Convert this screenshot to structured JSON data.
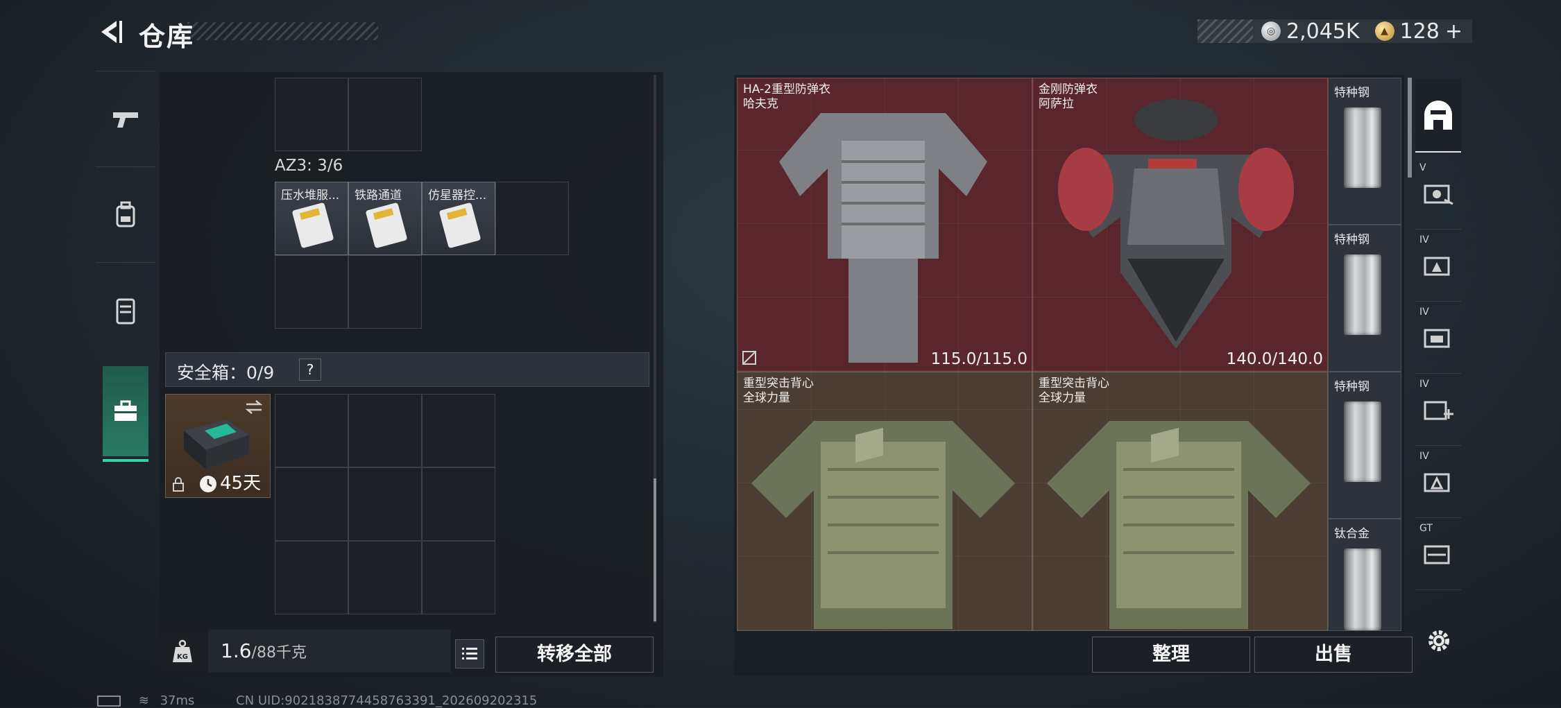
{
  "header": {
    "title": "仓库",
    "currency_silver": "2,045K",
    "currency_gold": "128",
    "gold_add": "+"
  },
  "sidebar": {
    "items": [
      {
        "icon": "pistol-icon"
      },
      {
        "icon": "backpack-icon"
      },
      {
        "icon": "vest-icon"
      },
      {
        "icon": "briefcase-icon",
        "active": true
      }
    ]
  },
  "left_panel": {
    "az3_label": "AZ3: 3/6",
    "az3_items": [
      {
        "label": "压水堆服..."
      },
      {
        "label": "铁路通道"
      },
      {
        "label": "仿星器控..."
      }
    ],
    "safe_box": {
      "label": "安全箱：0/9",
      "help": "?",
      "item_days": "45天"
    },
    "weight": {
      "current": "1.6",
      "max": "/88千克"
    },
    "transfer_all_label": "转移全部"
  },
  "right_panel": {
    "armors": [
      {
        "name": "HA-2重型防弹衣",
        "sub": "哈夫克",
        "durability": "115.0/115.0",
        "bg": "#5a262d"
      },
      {
        "name": "金刚防弹衣",
        "sub": "阿萨拉",
        "durability": "140.0/140.0",
        "bg": "#5a262d"
      },
      {
        "name": "重型突击背心",
        "sub": "全球力量",
        "durability": "",
        "bg": "#4a3d33"
      },
      {
        "name": "重型突击背心",
        "sub": "全球力量",
        "durability": "",
        "bg": "#4a3d33"
      }
    ],
    "plates": [
      {
        "label": "特种钢"
      },
      {
        "label": "特种钢"
      },
      {
        "label": "特种钢"
      },
      {
        "label": "钛合金"
      }
    ],
    "tabs": [
      {
        "tag": "",
        "icon": "helmet-icon"
      },
      {
        "tag": "V",
        "icon": "armor-tier-icon"
      },
      {
        "tag": "IV",
        "icon": "armor-tier-icon"
      },
      {
        "tag": "IV",
        "icon": "armor-tier-icon"
      },
      {
        "tag": "IV",
        "icon": "armor-plus-icon"
      },
      {
        "tag": "IV",
        "icon": "armor-tier-icon"
      },
      {
        "tag": "GT",
        "icon": "armor-tier-icon"
      }
    ],
    "sort_label": "整理",
    "sell_label": "出售"
  },
  "status_bar": {
    "ping": "37ms",
    "uid": "CN UID:9021838774458763391_202609202315"
  },
  "colors": {
    "accent": "#39d2a2",
    "armor_red": "#5a262d",
    "armor_brown": "#4a3d33"
  }
}
